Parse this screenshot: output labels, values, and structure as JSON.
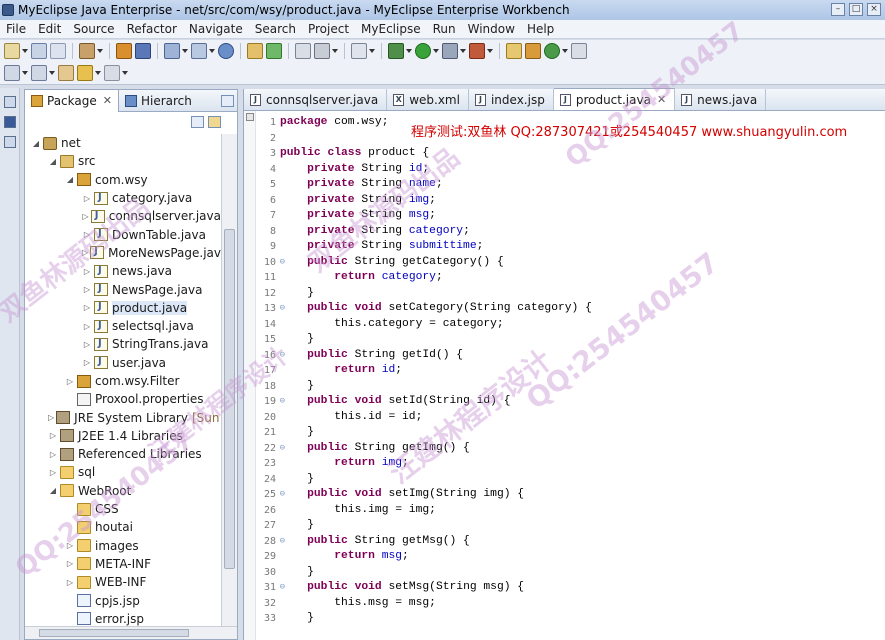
{
  "window": {
    "title": "MyEclipse Java Enterprise - net/src/com/wsy/product.java - MyEclipse Enterprise Workbench"
  },
  "menu": [
    "File",
    "Edit",
    "Source",
    "Refactor",
    "Navigate",
    "Search",
    "Project",
    "MyEclipse",
    "Run",
    "Window",
    "Help"
  ],
  "package_view": {
    "tabs": [
      {
        "label": "Package",
        "active": true
      },
      {
        "label": "Hierarch",
        "active": false
      }
    ],
    "tree": [
      {
        "label": "net",
        "icon": "project-icon",
        "indent": 0,
        "twisty": "open"
      },
      {
        "label": "src",
        "icon": "source-folder-icon",
        "indent": 1,
        "twisty": "open"
      },
      {
        "label": "com.wsy",
        "icon": "package-icon",
        "indent": 2,
        "twisty": "open"
      },
      {
        "label": "category.java",
        "icon": "java-file-icon",
        "indent": 3,
        "twisty": "closed"
      },
      {
        "label": "connsqlserver.java",
        "icon": "java-file-icon",
        "indent": 3,
        "twisty": "closed"
      },
      {
        "label": "DownTable.java",
        "icon": "java-file-icon",
        "indent": 3,
        "twisty": "closed"
      },
      {
        "label": "MoreNewsPage.java",
        "icon": "java-file-icon",
        "indent": 3,
        "twisty": "closed"
      },
      {
        "label": "news.java",
        "icon": "java-file-icon",
        "indent": 3,
        "twisty": "closed"
      },
      {
        "label": "NewsPage.java",
        "icon": "java-file-icon",
        "indent": 3,
        "twisty": "closed"
      },
      {
        "label": "product.java",
        "icon": "java-file-icon",
        "indent": 3,
        "twisty": "closed",
        "selected": true
      },
      {
        "label": "selectsql.java",
        "icon": "java-file-icon",
        "indent": 3,
        "twisty": "closed"
      },
      {
        "label": "StringTrans.java",
        "icon": "java-file-icon",
        "indent": 3,
        "twisty": "closed"
      },
      {
        "label": "user.java",
        "icon": "java-file-icon",
        "indent": 3,
        "twisty": "closed"
      },
      {
        "label": "com.wsy.Filter",
        "icon": "package-icon",
        "indent": 2,
        "twisty": "closed"
      },
      {
        "label": "Proxool.properties",
        "icon": "properties-file-icon",
        "indent": 2,
        "twisty": "none"
      },
      {
        "label": "JRE System Library",
        "suffix": "[Sun JD",
        "icon": "library-icon",
        "indent": 1,
        "twisty": "closed"
      },
      {
        "label": "J2EE 1.4 Libraries",
        "icon": "library-icon",
        "indent": 1,
        "twisty": "closed"
      },
      {
        "label": "Referenced Libraries",
        "icon": "library-icon",
        "indent": 1,
        "twisty": "closed"
      },
      {
        "label": "sql",
        "icon": "folder-icon",
        "indent": 1,
        "twisty": "closed"
      },
      {
        "label": "WebRoot",
        "icon": "folder-icon",
        "indent": 1,
        "twisty": "open"
      },
      {
        "label": "CSS",
        "icon": "folder-icon",
        "indent": 2,
        "twisty": "none"
      },
      {
        "label": "houtai",
        "icon": "folder-icon",
        "indent": 2,
        "twisty": "none"
      },
      {
        "label": "images",
        "icon": "folder-icon",
        "indent": 2,
        "twisty": "closed"
      },
      {
        "label": "META-INF",
        "icon": "folder-icon",
        "indent": 2,
        "twisty": "closed"
      },
      {
        "label": "WEB-INF",
        "icon": "folder-icon",
        "indent": 2,
        "twisty": "closed"
      },
      {
        "label": "cpjs.jsp",
        "icon": "jsp-file-icon",
        "indent": 2,
        "twisty": "none"
      },
      {
        "label": "error.jsp",
        "icon": "jsp-file-icon",
        "indent": 2,
        "twisty": "none"
      }
    ]
  },
  "editor": {
    "tabs": [
      {
        "label": "connsqlserver.java",
        "type": "J",
        "active": false
      },
      {
        "label": "web.xml",
        "type": "X",
        "active": false
      },
      {
        "label": "index.jsp",
        "type": "J",
        "active": false
      },
      {
        "label": "product.java",
        "type": "J",
        "active": true
      },
      {
        "label": "news.java",
        "type": "J",
        "active": false
      }
    ],
    "banner": "程序测试:双鱼林 QQ:287307421或254540457 www.shuangyulin.com",
    "code_lines": [
      {
        "n": "1",
        "text": "package com.wsy;"
      },
      {
        "n": "2",
        "text": ""
      },
      {
        "n": "3",
        "text": "public class product {"
      },
      {
        "n": "4",
        "text": "    private String id;"
      },
      {
        "n": "5",
        "text": "    private String name;"
      },
      {
        "n": "6",
        "text": "    private String img;"
      },
      {
        "n": "7",
        "text": "    private String msg;"
      },
      {
        "n": "8",
        "text": "    private String category;"
      },
      {
        "n": "9",
        "text": "    private String submittime;"
      },
      {
        "n": "10",
        "text": "    public String getCategory() {",
        "fold": true
      },
      {
        "n": "11",
        "text": "        return category;"
      },
      {
        "n": "12",
        "text": "    }"
      },
      {
        "n": "13",
        "text": "    public void setCategory(String category) {",
        "fold": true
      },
      {
        "n": "14",
        "text": "        this.category = category;"
      },
      {
        "n": "15",
        "text": "    }"
      },
      {
        "n": "16",
        "text": "    public String getId() {",
        "fold": true
      },
      {
        "n": "17",
        "text": "        return id;"
      },
      {
        "n": "18",
        "text": "    }"
      },
      {
        "n": "19",
        "text": "    public void setId(String id) {",
        "fold": true
      },
      {
        "n": "20",
        "text": "        this.id = id;"
      },
      {
        "n": "21",
        "text": "    }"
      },
      {
        "n": "22",
        "text": "    public String getImg() {",
        "fold": true
      },
      {
        "n": "23",
        "text": "        return img;"
      },
      {
        "n": "24",
        "text": "    }"
      },
      {
        "n": "25",
        "text": "    public void setImg(String img) {",
        "fold": true
      },
      {
        "n": "26",
        "text": "        this.img = img;"
      },
      {
        "n": "27",
        "text": "    }"
      },
      {
        "n": "28",
        "text": "    public String getMsg() {",
        "fold": true
      },
      {
        "n": "29",
        "text": "        return msg;"
      },
      {
        "n": "30",
        "text": "    }"
      },
      {
        "n": "31",
        "text": "    public void setMsg(String msg) {",
        "fold": true
      },
      {
        "n": "32",
        "text": "        this.msg = msg;"
      },
      {
        "n": "33",
        "text": "    }"
      }
    ]
  },
  "watermarks": [
    "QQ:254540457",
    "汪建林程序设计",
    "双鱼林源码出品",
    "QQ:254540457",
    "汪建林程序设计",
    "QQ:254540457",
    "双鱼林源码出品"
  ],
  "colors": {
    "keyword": "#7f0055",
    "field": "#0000c0",
    "banner": "#d40000",
    "watermark": "#c896d2"
  }
}
